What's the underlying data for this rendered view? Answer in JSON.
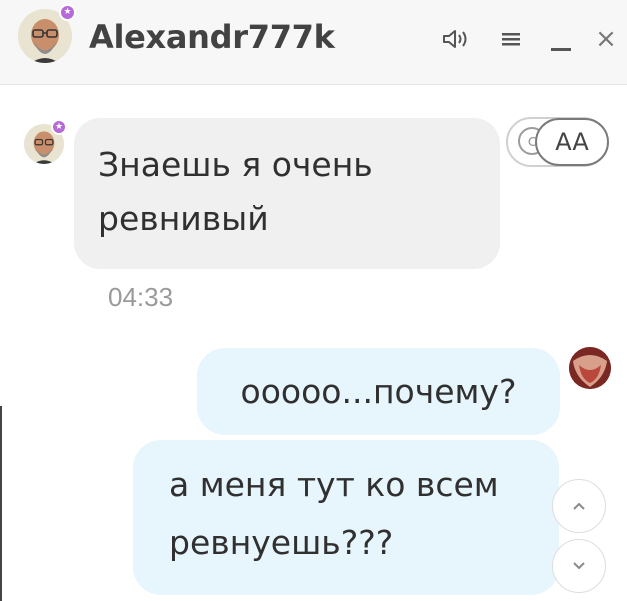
{
  "header": {
    "title": "Alexandr777k",
    "controls": {
      "sound_icon": "speaker-icon",
      "menu_icon": "hamburger-menu-icon",
      "minimize_label": "_",
      "close_label": "×"
    }
  },
  "messages": [
    {
      "direction": "incoming",
      "text_lines": [
        "Знаешь я очень",
        "ревнивый"
      ],
      "time": "04:33"
    },
    {
      "direction": "outgoing",
      "text": "ооооо...почему?"
    },
    {
      "direction": "outgoing",
      "text_lines": [
        "а меня тут ко всем",
        "ревнуешь???"
      ]
    }
  ],
  "translate": {
    "label": "AA"
  },
  "scroll": {
    "up_glyph": "⌃",
    "down_glyph": "⌄"
  },
  "colors": {
    "incoming_bubble": "#f0f0f0",
    "outgoing_bubble": "#e7f5fd",
    "online_badge": "#b56ad6",
    "header_bg": "#f7f7f7"
  }
}
